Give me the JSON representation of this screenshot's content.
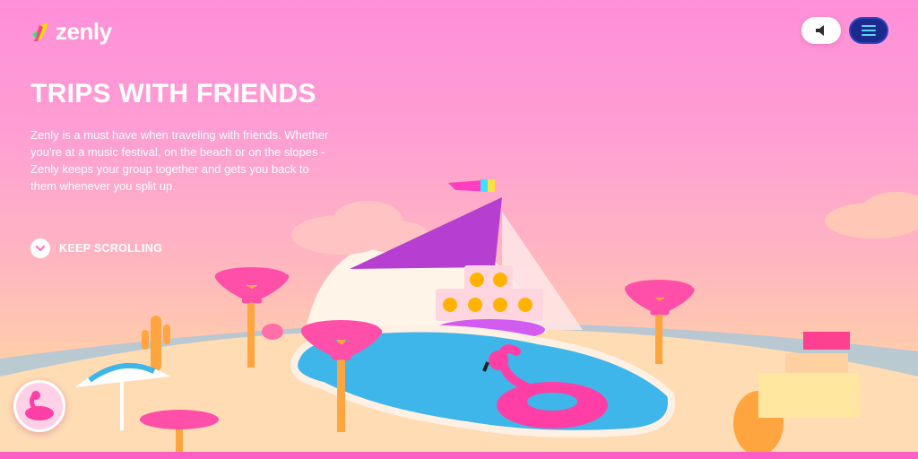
{
  "header": {
    "logo_text": "zenly",
    "logo_icon": "zenly-bolt-logo-icon",
    "sound_icon": "speaker-icon",
    "menu_icon": "hamburger-menu-icon"
  },
  "hero": {
    "title": "TRIPS WITH FRIENDS",
    "body": "Zenly is a must have when traveling with friends. Whether you're at a music festival, on the beach or on the slopes - Zenly keeps your group together and gets you back to them whenever you split up.",
    "scroll_label": "KEEP SCROLLING",
    "scroll_icon": "chevron-down-icon"
  },
  "scene": {
    "description_icons": [
      "flamingo-float-icon",
      "palm-tree-icon",
      "speaker-stack-icon",
      "beach-umbrella-icon",
      "cactus-icon",
      "bar-stand-icon"
    ]
  },
  "colors": {
    "brand_pink": "#ff8fd9",
    "menu_blue": "#1b2a8c",
    "pool_blue": "#3fb6ea",
    "sand": "#ffd9b0",
    "palm_pink": "#ff4fa8"
  }
}
